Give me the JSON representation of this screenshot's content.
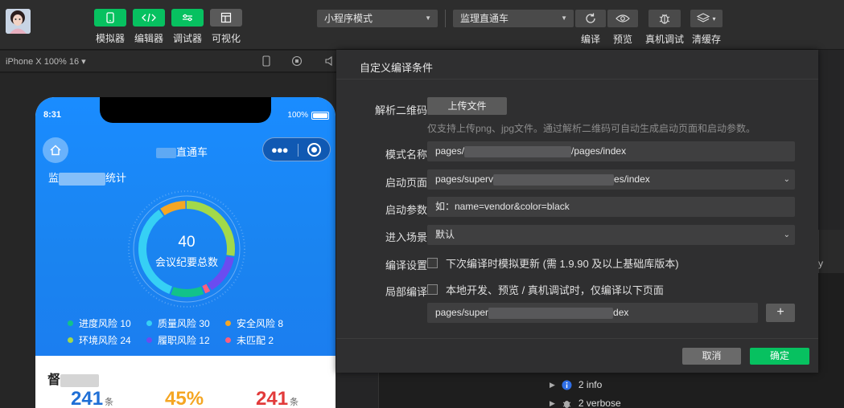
{
  "toolbar": {
    "left_buttons": [
      {
        "label": "模拟器",
        "icon": "phone-icon",
        "style": "green"
      },
      {
        "label": "编辑器",
        "icon": "code-icon",
        "style": "green"
      },
      {
        "label": "调试器",
        "icon": "sliders-icon",
        "style": "green"
      },
      {
        "label": "可视化",
        "icon": "layout-icon",
        "style": "gray"
      }
    ],
    "mode_select": "小程序模式",
    "page_select": "监理直通车",
    "right_buttons": [
      {
        "label": "编译",
        "icon": "refresh-icon"
      },
      {
        "label": "预览",
        "icon": "eye-icon"
      },
      {
        "label": "真机调试",
        "icon": "bug-icon"
      },
      {
        "label": "清缓存",
        "icon": "layers-icon"
      }
    ]
  },
  "simulator": {
    "device": "iPhone X 100% 16 ▾"
  },
  "phone": {
    "time": "8:31",
    "battery": "100%",
    "nav_title": "直通车",
    "stats_title_prefix": "监",
    "stats_title_suffix": "统计",
    "gauge_total": "40",
    "gauge_label": "会议纪要总数",
    "legend": [
      {
        "label": "进度风险 10",
        "color": "#12c28a"
      },
      {
        "label": "质量风险 30",
        "color": "#36d0f5"
      },
      {
        "label": "安全风险 8",
        "color": "#f5a623"
      },
      {
        "label": "环境风险 24",
        "color": "#a2d94a"
      },
      {
        "label": "履职风险 12",
        "color": "#6b4cf0"
      },
      {
        "label": "未匹配 2",
        "color": "#ff5e7e"
      }
    ],
    "card_title": "督",
    "kpis": [
      {
        "value": "241",
        "unit": "条",
        "color": "#1f6fd6"
      },
      {
        "value": "45%",
        "unit": "",
        "color": "#f5a623"
      },
      {
        "value": "241",
        "unit": "条",
        "color": "#e23a3a"
      }
    ]
  },
  "dialog": {
    "title": "自定义编译条件",
    "qr_label": "解析二维码",
    "upload_label": "上传文件",
    "hint": "仅支持上传png、jpg文件。通过解析二维码可自动生成启动页面和启动参数。",
    "mode_name_label": "模式名称",
    "mode_name_prefix": "pages/",
    "mode_name_suffix": "/pages/index",
    "start_page_label": "启动页面",
    "start_page_prefix": "pages/superv",
    "start_page_suffix": "es/index",
    "start_params_label": "启动参数",
    "start_params_placeholder": "如：name=vendor&color=black",
    "scene_label": "进入场景",
    "scene_value": "默认",
    "compile_settings_label": "编译设置",
    "compile_settings_text": "下次编译时模拟更新 (需 1.9.90 及以上基础库版本)",
    "partial_compile_label": "局部编译",
    "partial_compile_text": "本地开发、预览 / 真机调试时，仅编译以下页面",
    "partial_page_prefix": "pages/super",
    "partial_page_suffix": "dex",
    "cancel_label": "取消",
    "ok_label": "确定"
  },
  "console": {
    "rows": [
      {
        "label": "2 info",
        "icon": "info-icon"
      },
      {
        "label": "2 verbose",
        "icon": "verbose-icon"
      }
    ],
    "side_text": "y"
  }
}
